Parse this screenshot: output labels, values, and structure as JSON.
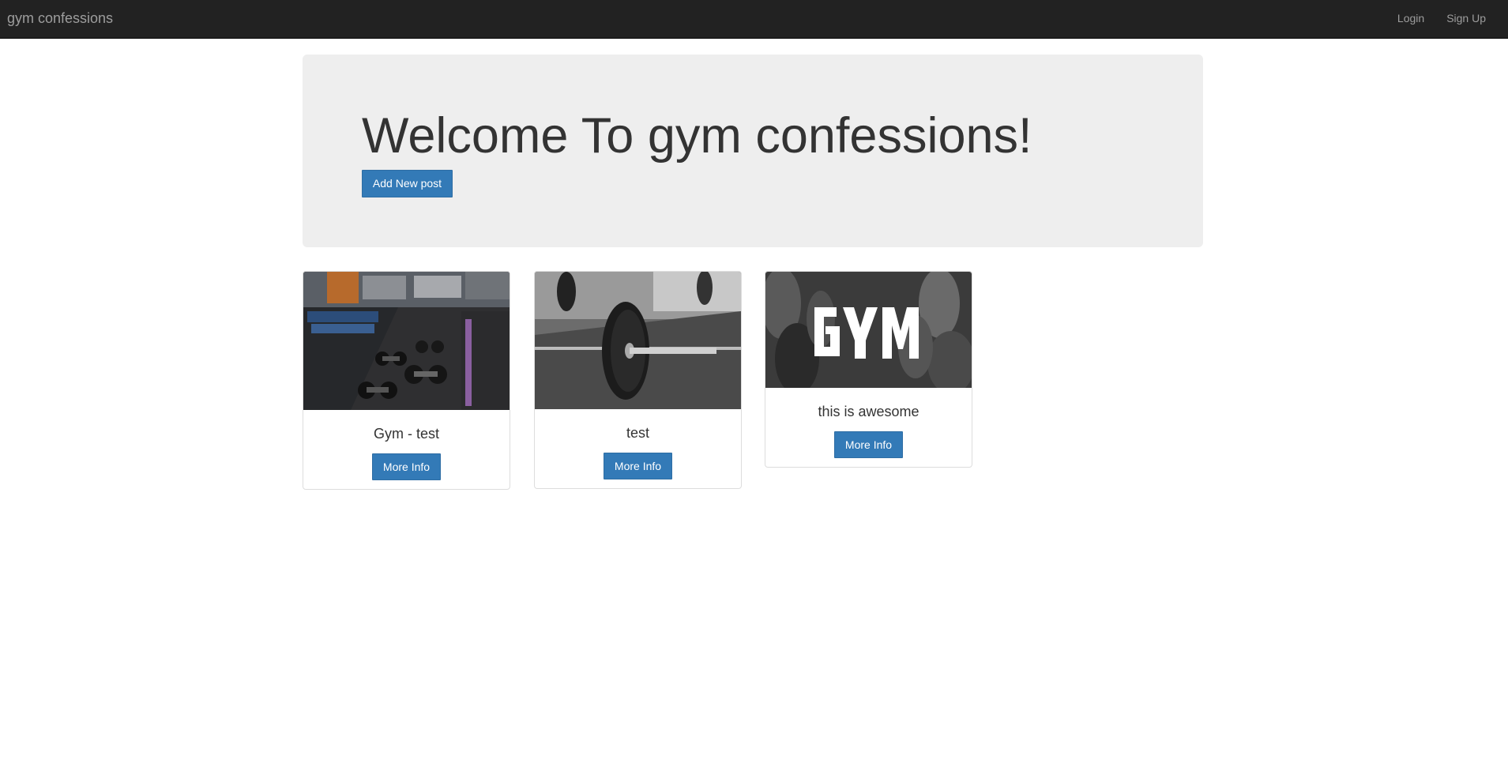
{
  "navbar": {
    "brand": "gym confessions",
    "links": [
      {
        "label": "Login"
      },
      {
        "label": "Sign Up"
      }
    ]
  },
  "jumbotron": {
    "title": "Welcome To gym confessions!",
    "add_button": "Add New post"
  },
  "posts": [
    {
      "title": "Gym - test",
      "button": "More Info",
      "image": "gym-floor-dumbbells-photo"
    },
    {
      "title": "test",
      "button": "More Info",
      "image": "barbell-plate-photo"
    },
    {
      "title": "this is awesome",
      "button": "More Info",
      "image": "gym-logo-dumbbells-photo"
    }
  ],
  "colors": {
    "navbar_bg": "#222222",
    "navbar_text": "#9d9d9d",
    "jumbotron_bg": "#eeeeee",
    "primary_button": "#337ab7"
  }
}
